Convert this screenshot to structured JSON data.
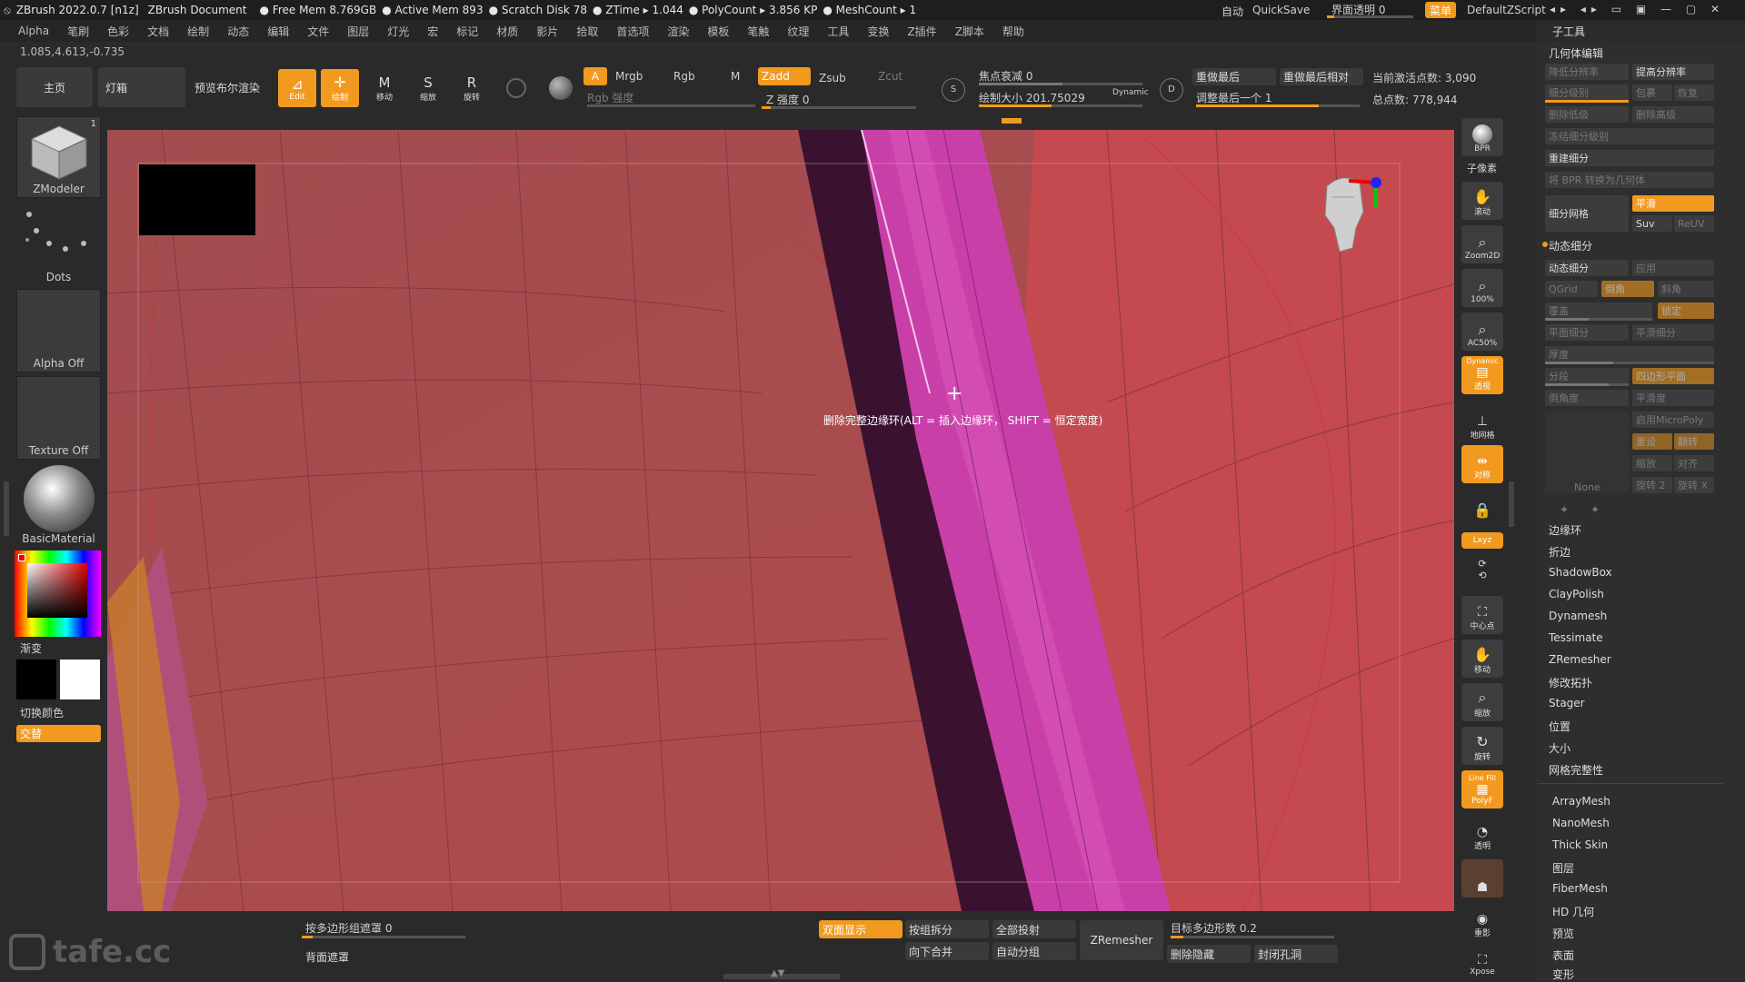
{
  "titlebar": {
    "app": "ZBrush 2022.0.7 [n1z]",
    "doc": "ZBrush Document",
    "stats": [
      "Free Mem 8.769GB",
      "Active Mem 893",
      "Scratch Disk 78",
      "ZTime ▸ 1.044",
      "PolyCount ▸ 3.856 KP",
      "MeshCount ▸ 1"
    ],
    "auto": "自动",
    "quicksave": "QuickSave",
    "ui_transparency": "界面透明 0",
    "menu_btn": "菜单",
    "script": "DefaultZScript"
  },
  "menubar": [
    "Alpha",
    "笔刷",
    "色彩",
    "文档",
    "绘制",
    "动态",
    "编辑",
    "文件",
    "图层",
    "灯光",
    "宏",
    "标记",
    "材质",
    "影片",
    "拾取",
    "首选项",
    "渲染",
    "模板",
    "笔触",
    "纹理",
    "工具",
    "变换",
    "Z插件",
    "Z脚本",
    "帮助"
  ],
  "coords": "1.085,4.613,-0.735",
  "toolbar": {
    "home": "主页",
    "lightbox": "灯箱",
    "preview_render": "预览布尔渲染",
    "edit": "Edit",
    "draw": "绘制",
    "move": "移动",
    "scale": "缩放",
    "rotate": "旋转",
    "a_btn": "A",
    "mrgb": "Mrgb",
    "rgb": "Rgb",
    "m": "M",
    "zadd": "Zadd",
    "zsub": "Zsub",
    "zcut": "Zcut",
    "rgb_intensity": "Rgb 强度",
    "z_intensity": "Z 强度 0",
    "focal_shift": "焦点衰减 0",
    "draw_size": "绘制大小 201.75029",
    "dynamic": "Dynamic",
    "redo_last": "重做最后",
    "redo_last_rel": "重做最后相对",
    "adjust_last": "调整最后一个 1",
    "active_points": "当前激活点数: 3,090",
    "total_points": "总点数: 778,944",
    "s_label": "S",
    "d_label": "D"
  },
  "leftbar": {
    "tool": "ZModeler",
    "tool_count": "1",
    "dots": "Dots",
    "alpha": "Alpha Off",
    "texture": "Texture Off",
    "material": "BasicMaterial",
    "gradient": "渐变",
    "switch_color": "切换颜色",
    "alternate": "交替"
  },
  "viewport": {
    "tooltip": "删除完整边缘环(ALT = 插入边缘环， SHIFT = 恒定宽度)"
  },
  "rightstrip": [
    "BPR",
    "子像素",
    "滚动",
    "Zoom2D",
    "100%",
    "AC50%",
    "透视",
    "地网格",
    "对称",
    "Lxyz",
    "中心点",
    "移动",
    "缩放",
    "旋转",
    "PolyF",
    "透明",
    "重影",
    "Xpose"
  ],
  "rightstrip_labels": {
    "dynamic": "Dynamic",
    "linefill": "Line Fill"
  },
  "panel": {
    "header": "子工具",
    "section": "几何体编辑",
    "lower_res": "降低分辨率",
    "higher_res": "提高分辨率",
    "sdiv": "细分级别",
    "cage": "包裹",
    "restore": "恢复",
    "del_lower": "删除低级",
    "del_higher": "删除高级",
    "freeze": "冻结细分级别",
    "reconstruct": "重建细分",
    "bpr_to_geo": "将 BPR 转换为几何体",
    "divide": "细分网格",
    "smooth": "平滑",
    "suv": "Suv",
    "reuv": "ReUV",
    "dyn_sub_header": "动态细分",
    "dyn_sub": "动态细分",
    "apply": "应用",
    "qgrid": "QGrid",
    "coverage": "覆盖",
    "chamfer": "倒角",
    "bevel": "斜角",
    "lock": "锁定",
    "flat_sub": "平面细分",
    "smooth_sub": "平滑细分",
    "thickness": "厚度",
    "segments": "分段",
    "smooth_surface": "四边形平面",
    "bevel_angle": "倒角度",
    "smooth_level": "平滑度",
    "micropoly": "启用MicroPoly",
    "reset": "重设",
    "flip": "翻转",
    "scale": "缩放",
    "align": "对齐",
    "none": "None",
    "rotate2": "旋转 2",
    "rotatex": "旋转 X",
    "list": [
      "边缘环",
      "折边",
      "ShadowBox",
      "ClayPolish",
      "Dynamesh",
      "Tessimate",
      "ZRemesher",
      "修改拓扑",
      "Stager",
      "位置",
      "大小",
      "网格完整性"
    ],
    "list2": [
      "ArrayMesh",
      "NanoMesh",
      "Thick Skin",
      "图层",
      "FiberMesh",
      "HD 几何",
      "预览",
      "表面",
      "变形"
    ]
  },
  "bottombar": {
    "mask_by_polygroup": "按多边形组遮罩 0",
    "backface_mask": "背面遮罩",
    "double": "双面显示",
    "split_groups": "按组拆分",
    "project_all": "全部投射",
    "merge_down": "向下合并",
    "auto_groups": "自动分组",
    "zremesher": "ZRemesher",
    "target_poly": "目标多边形数 0.2",
    "del_hidden": "删除隐藏",
    "close_holes": "封闭孔洞"
  },
  "watermark": "tafe.cc",
  "colors": {
    "accent": "#f29a1f",
    "mesh_red": "#9e4a4a",
    "mesh_pink": "#c83fa8",
    "dark_purple": "#3d1530"
  }
}
